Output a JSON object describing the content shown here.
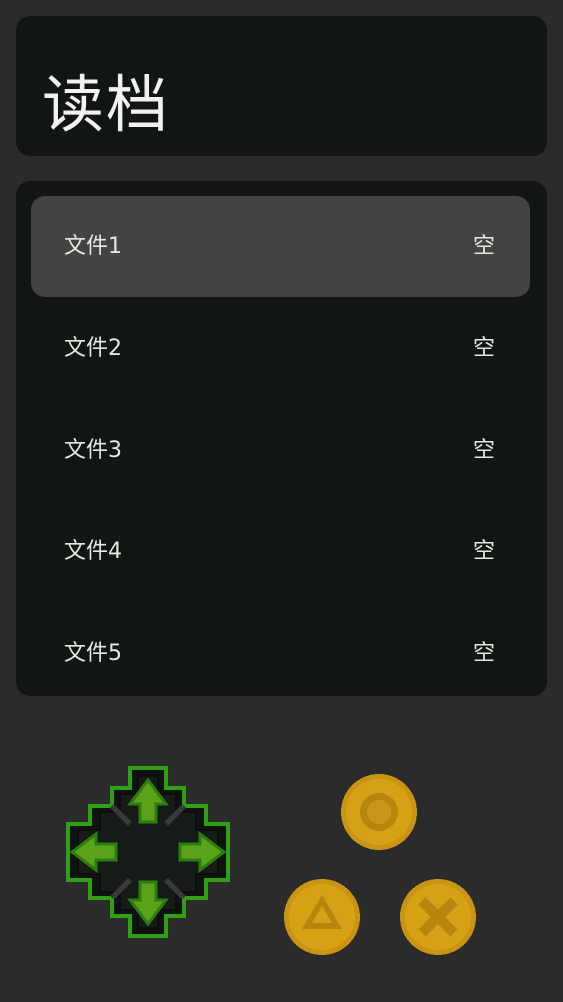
{
  "screen": {
    "title": "读档"
  },
  "save_slots": [
    {
      "label": "文件1",
      "status": "空",
      "selected": true
    },
    {
      "label": "文件2",
      "status": "空",
      "selected": false
    },
    {
      "label": "文件3",
      "status": "空",
      "selected": false
    },
    {
      "label": "文件4",
      "status": "空",
      "selected": false
    },
    {
      "label": "文件5",
      "status": "空",
      "selected": false
    }
  ],
  "controls": {
    "dpad_icon": "dpad-icon",
    "buttons": [
      {
        "name": "circle-button",
        "icon": "circle-icon"
      },
      {
        "name": "triangle-button",
        "icon": "triangle-icon"
      },
      {
        "name": "cross-button",
        "icon": "cross-icon"
      }
    ]
  },
  "colors": {
    "background": "#2b2b2b",
    "panel": "#121613",
    "selected_slot": "#434442",
    "text": "#e6e6e3",
    "dpad_green": "#5aa319",
    "dpad_outline": "#2da014",
    "button_gold": "#ffc413"
  }
}
